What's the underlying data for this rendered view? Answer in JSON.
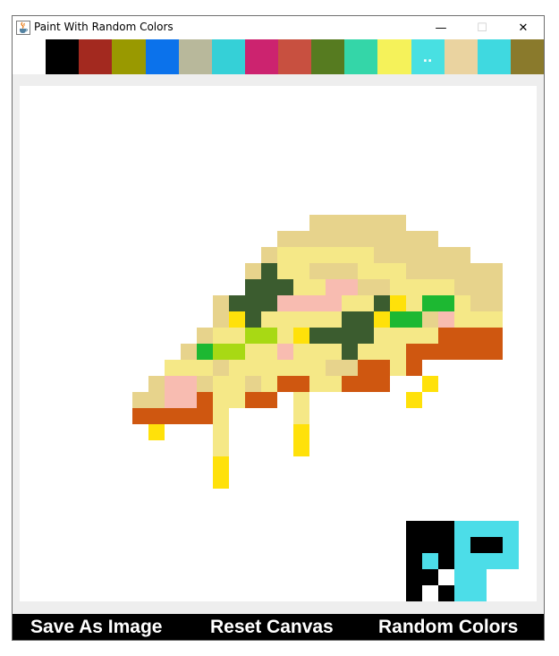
{
  "window": {
    "title": "Paint With Random Colors",
    "app_icon": "java-cup-icon",
    "controls": {
      "minimize": "—",
      "maximize": "☐",
      "close": "✕"
    }
  },
  "palette": {
    "colors": [
      "#ffffff",
      "#000000",
      "#a3291f",
      "#999900",
      "#0b72eb",
      "#b8b89b",
      "#35d0d7",
      "#cc236f",
      "#c85040",
      "#567b20",
      "#34d6a8",
      "#f5f25a",
      "#48e0e2",
      "#ead3a0",
      "#3fd9e0",
      "#8a7a2c"
    ],
    "more_label": ".."
  },
  "canvas": {
    "pixel_size": 18,
    "palette": {
      "C": "#e7d38c",
      "Y": "#f5e887",
      "G": "#3b5c2f",
      "P": "#f8bcb1",
      "O": "#cf5710",
      "Q": "#ffe10a",
      "B": "#1db832",
      "L": "#a8d914",
      "K": "#000000",
      "T": "#4cdde8",
      "W": "#ffffff"
    },
    "pizza_grid": [
      "............CCCCCC......",
      "..........CCCCCCCCCC....",
      ".........CYYYYYYCCCCCC..",
      "........CGYYCCCYYYCCCCCC",
      "........GGGYYPPCCYYYYCCC",
      "......CGGGPPPPYYGQYBBYCC",
      "......CQGYYYYYGGQBBCPYYY",
      ".....CYYLLYQGGGGYYYYOOOO",
      "....CBLLYYPYYYGYYYOOOOOO",
      "...YYYCYYYYYYCCOOYO.....",
      "..CPPCYYCYOOYYOOO..Q....",
      ".CCPPOYYOO.Y......Q.....",
      ".OOOOOY....Y............",
      "..Q...Y....Q............",
      "......Y....Q............",
      "......Q.................",
      "......Q................."
    ],
    "pizza_origin": {
      "col": 6,
      "row": 8
    },
    "logo_grid": [
      "KKKTTTT",
      "KKKTKKT",
      "KTKTTTT",
      "KKWTT..",
      "KWKTT.."
    ],
    "logo_origin": {
      "col": 24,
      "row": 27
    }
  },
  "buttons": {
    "save": "Save As Image",
    "reset": "Reset Canvas",
    "random": "Random Colors"
  }
}
